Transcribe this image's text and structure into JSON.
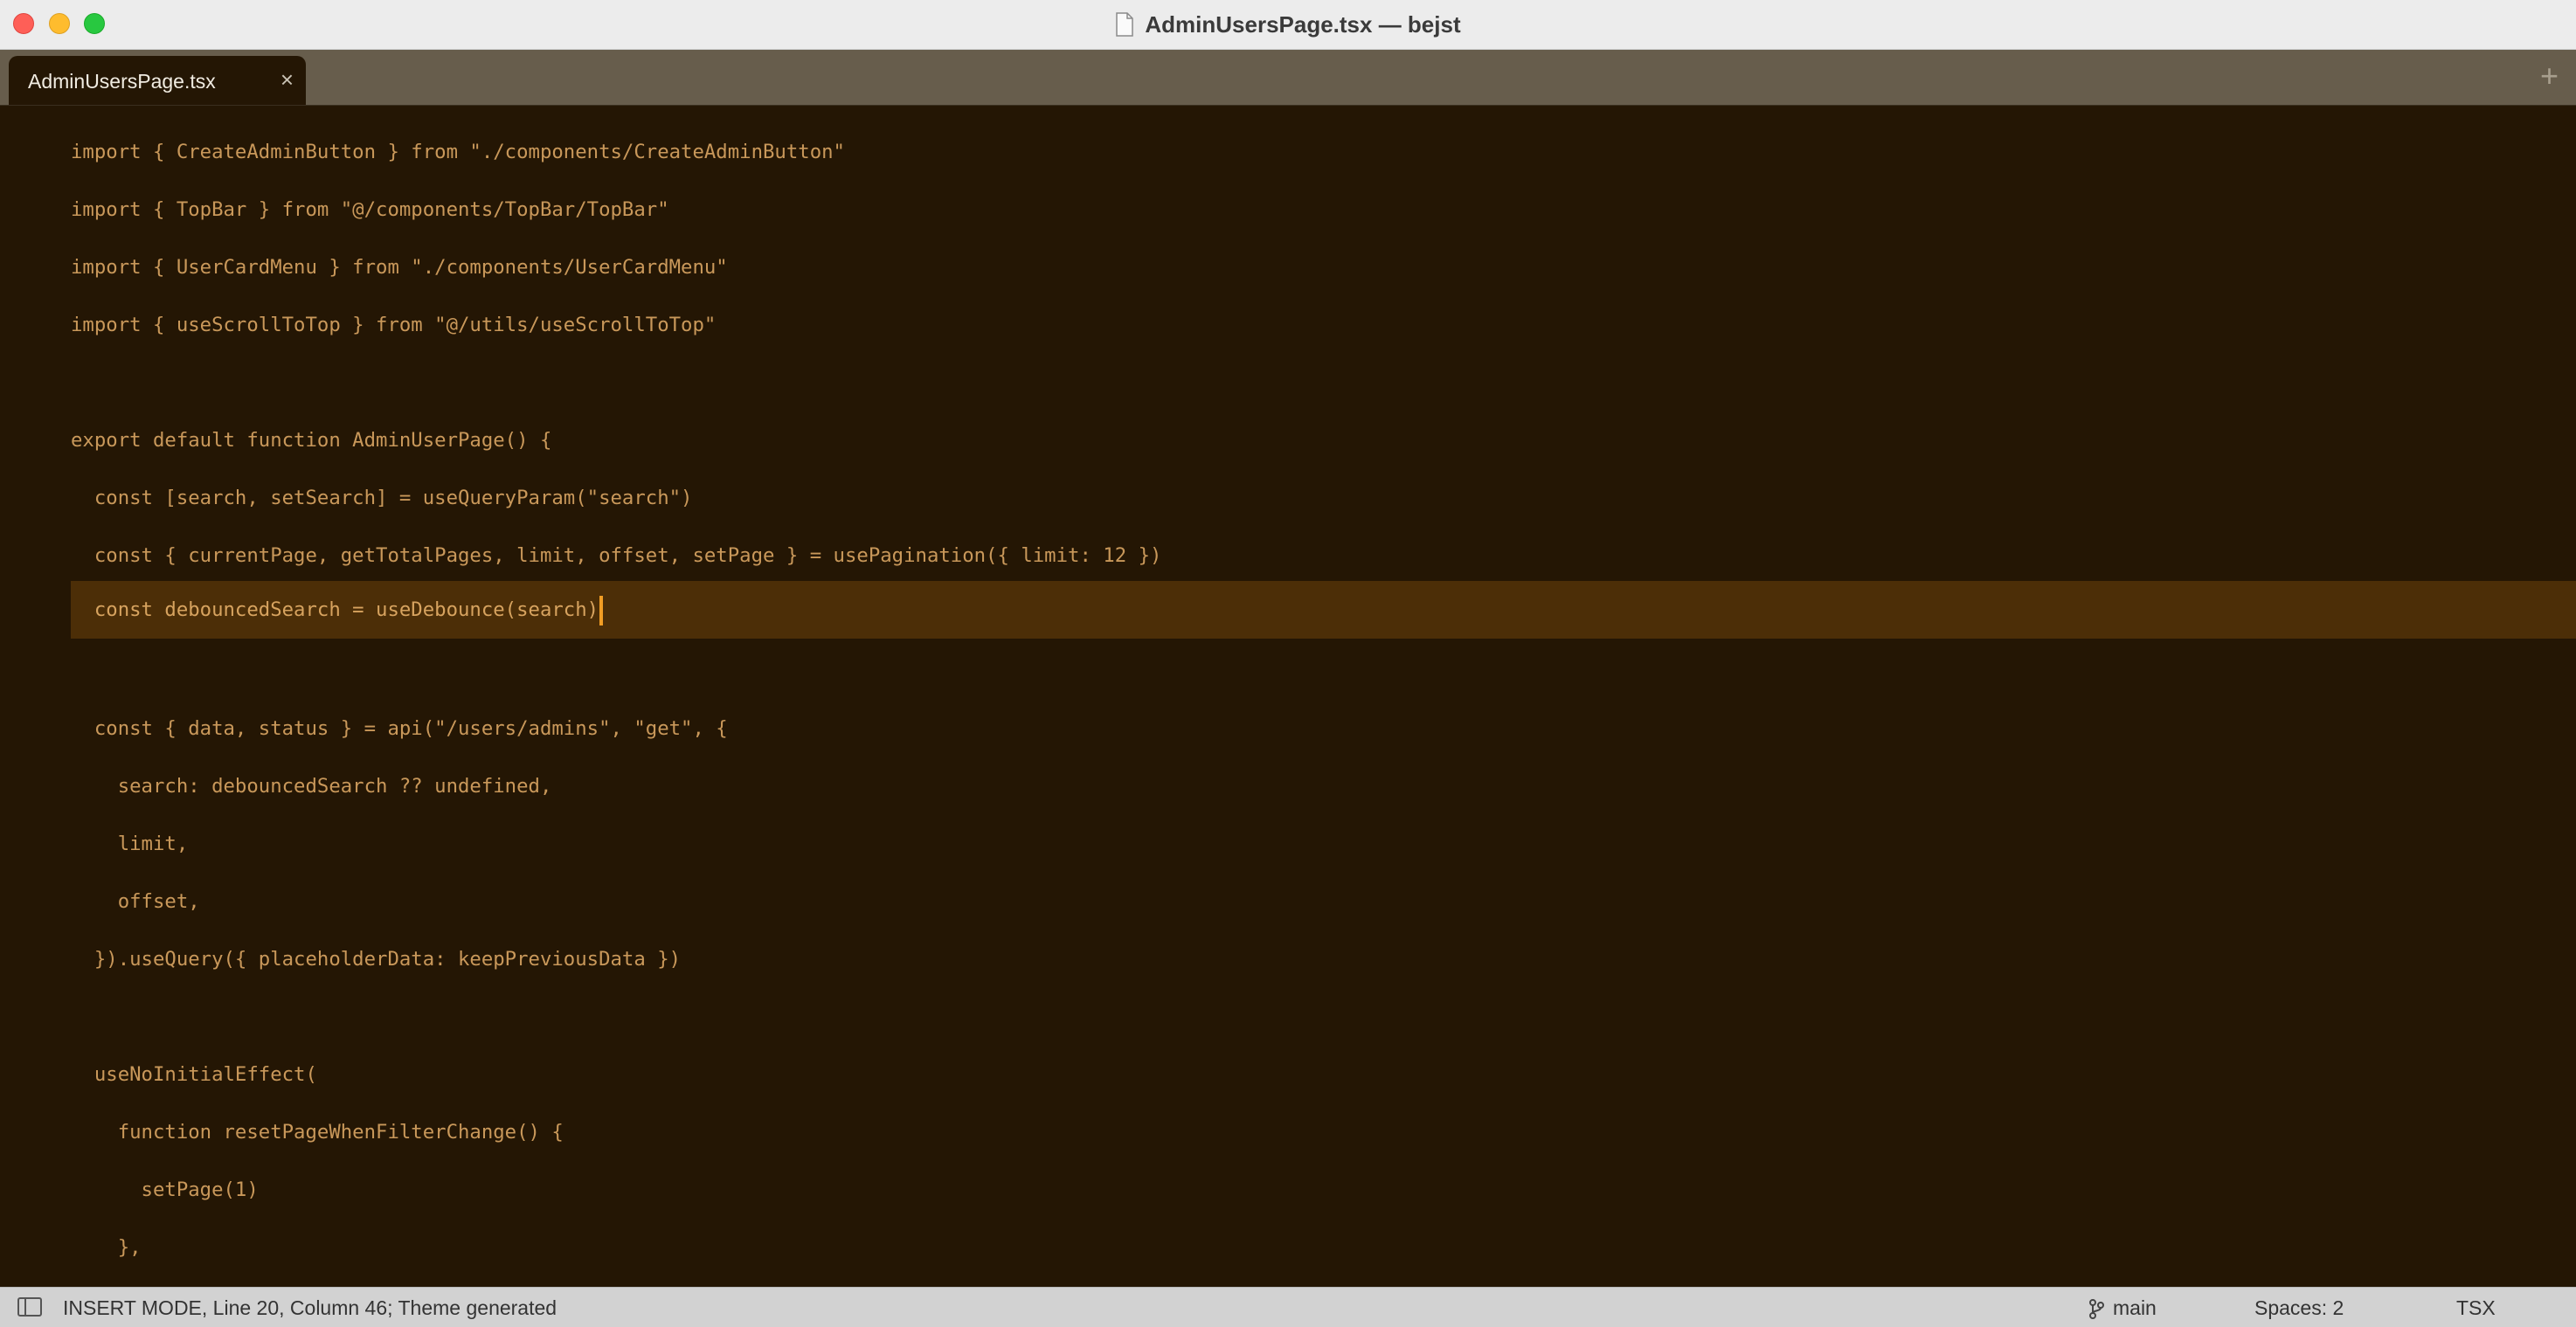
{
  "window": {
    "title": "AdminUsersPage.tsx — bejst"
  },
  "tabs": [
    {
      "label": "AdminUsersPage.tsx"
    }
  ],
  "code": {
    "line1": "import { CreateAdminButton } from \"./components/CreateAdminButton\"",
    "line2": "import { TopBar } from \"@/components/TopBar/TopBar\"",
    "line3": "import { UserCardMenu } from \"./components/UserCardMenu\"",
    "line4": "import { useScrollToTop } from \"@/utils/useScrollToTop\"",
    "line6": "export default function AdminUserPage() {",
    "line7": "  const [search, setSearch] = useQueryParam(\"search\")",
    "line8": "  const { currentPage, getTotalPages, limit, offset, setPage } = usePagination({ limit: 12 })",
    "line9": "  const debouncedSearch = useDebounce(search)",
    "line11": "  const { data, status } = api(\"/users/admins\", \"get\", {",
    "line12": "    search: debouncedSearch ?? undefined,",
    "line13": "    limit,",
    "line14": "    offset,",
    "line15": "  }).useQuery({ placeholderData: keepPreviousData })",
    "line17": "  useNoInitialEffect(",
    "line18": "    function resetPageWhenFilterChange() {",
    "line19": "      setPage(1)",
    "line20": "    },"
  },
  "status": {
    "mode": "INSERT MODE, Line 20, Column 46; Theme generated",
    "branch": "main",
    "spaces": "Spaces: 2",
    "language": "TSX"
  },
  "icons": {
    "tab_close": "×",
    "tab_add": "+"
  },
  "colors": {
    "editor_bg": "#241604",
    "current_line": "#4c2e07",
    "caret": "#f19d24"
  }
}
